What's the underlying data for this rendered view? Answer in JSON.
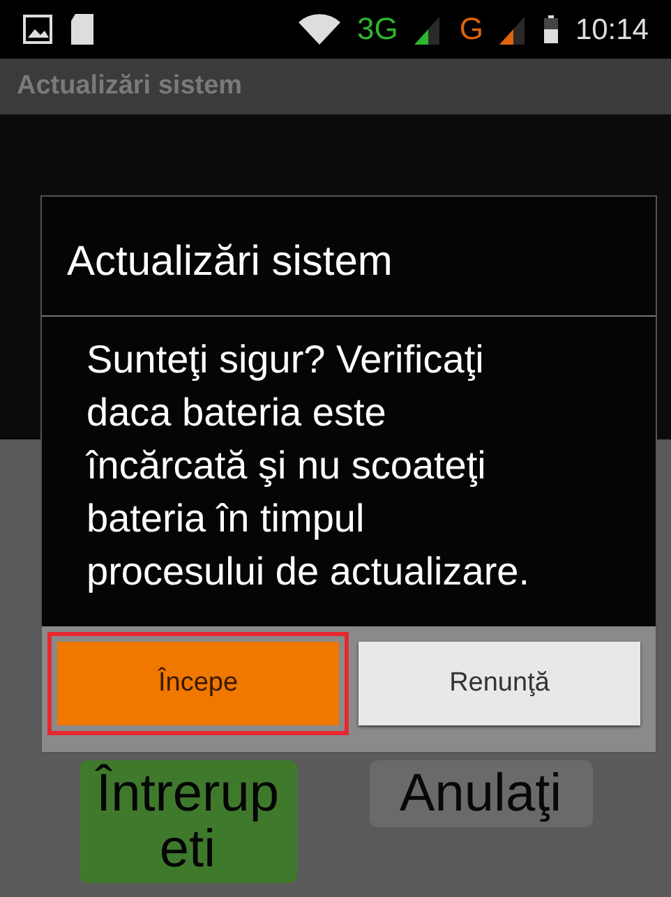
{
  "status_bar": {
    "time": "10:14",
    "network_3g": "3G",
    "network_g": "G"
  },
  "app_bar": {
    "title": "Actualizări sistem"
  },
  "background_buttons": [
    {
      "label": "Întrerupeti",
      "kind": "primary"
    },
    {
      "label": "Anulaţi",
      "kind": "secondary"
    }
  ],
  "dialog": {
    "title": "Actualizări sistem",
    "message": "Sunteţi sigur? Verificaţi daca bateria este încărcată şi nu scoateţi bateria în timpul procesului de actualizare.",
    "buttons": [
      {
        "label": "Începe",
        "kind": "primary",
        "highlighted": true
      },
      {
        "label": "Renunţă",
        "kind": "secondary",
        "highlighted": false
      }
    ]
  }
}
